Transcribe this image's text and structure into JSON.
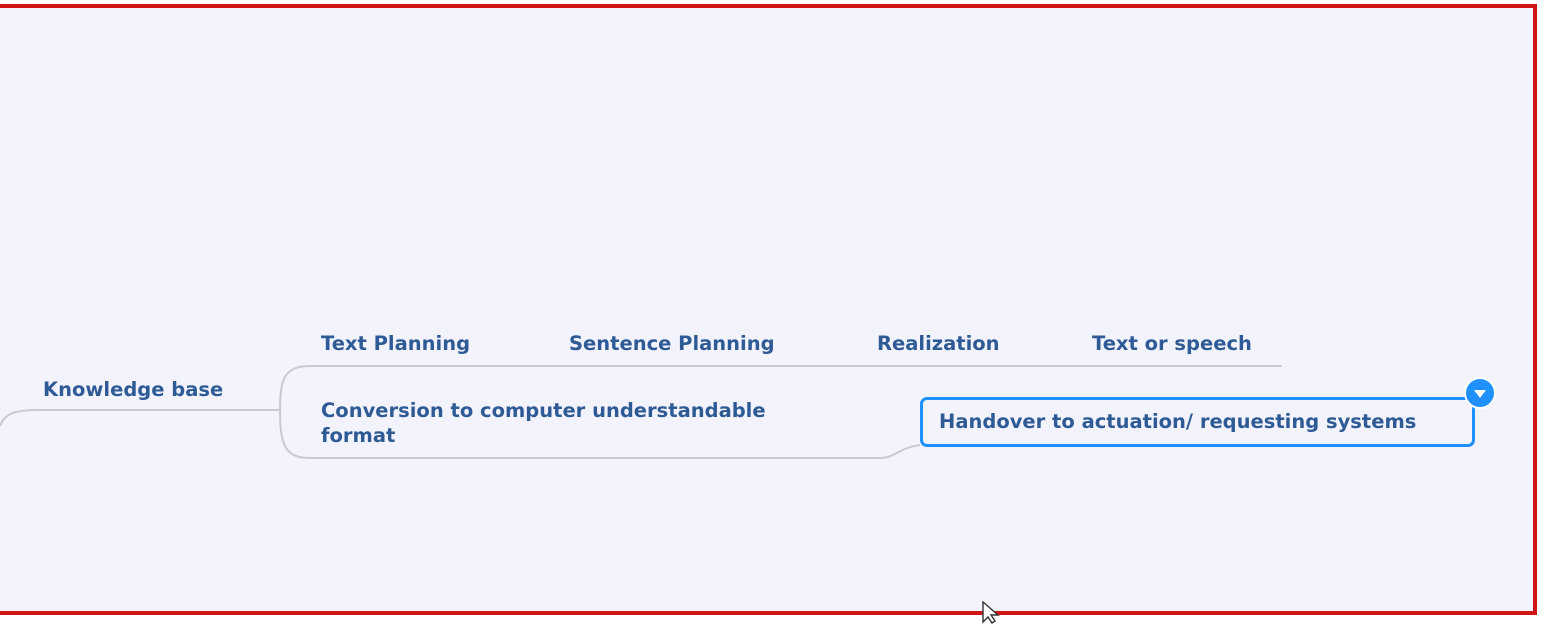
{
  "diagram": {
    "nodes": {
      "knowledge_base": "Knowledge base",
      "text_planning": "Text Planning",
      "sentence_planning": "Sentence Planning",
      "realization": "Realization",
      "text_or_speech": "Text or speech",
      "conversion": "Conversion to computer understandable format",
      "handover": "Handover to actuation/ requesting systems"
    },
    "colors": {
      "frame_border": "#d01515",
      "background": "#f3f3fd",
      "text": "#2e5b96",
      "selection": "#1e90ff",
      "connector": "#c9c9d4"
    },
    "icons": {
      "toggle": "collapse-toggle-icon",
      "cursor": "mouse-cursor-icon"
    }
  }
}
